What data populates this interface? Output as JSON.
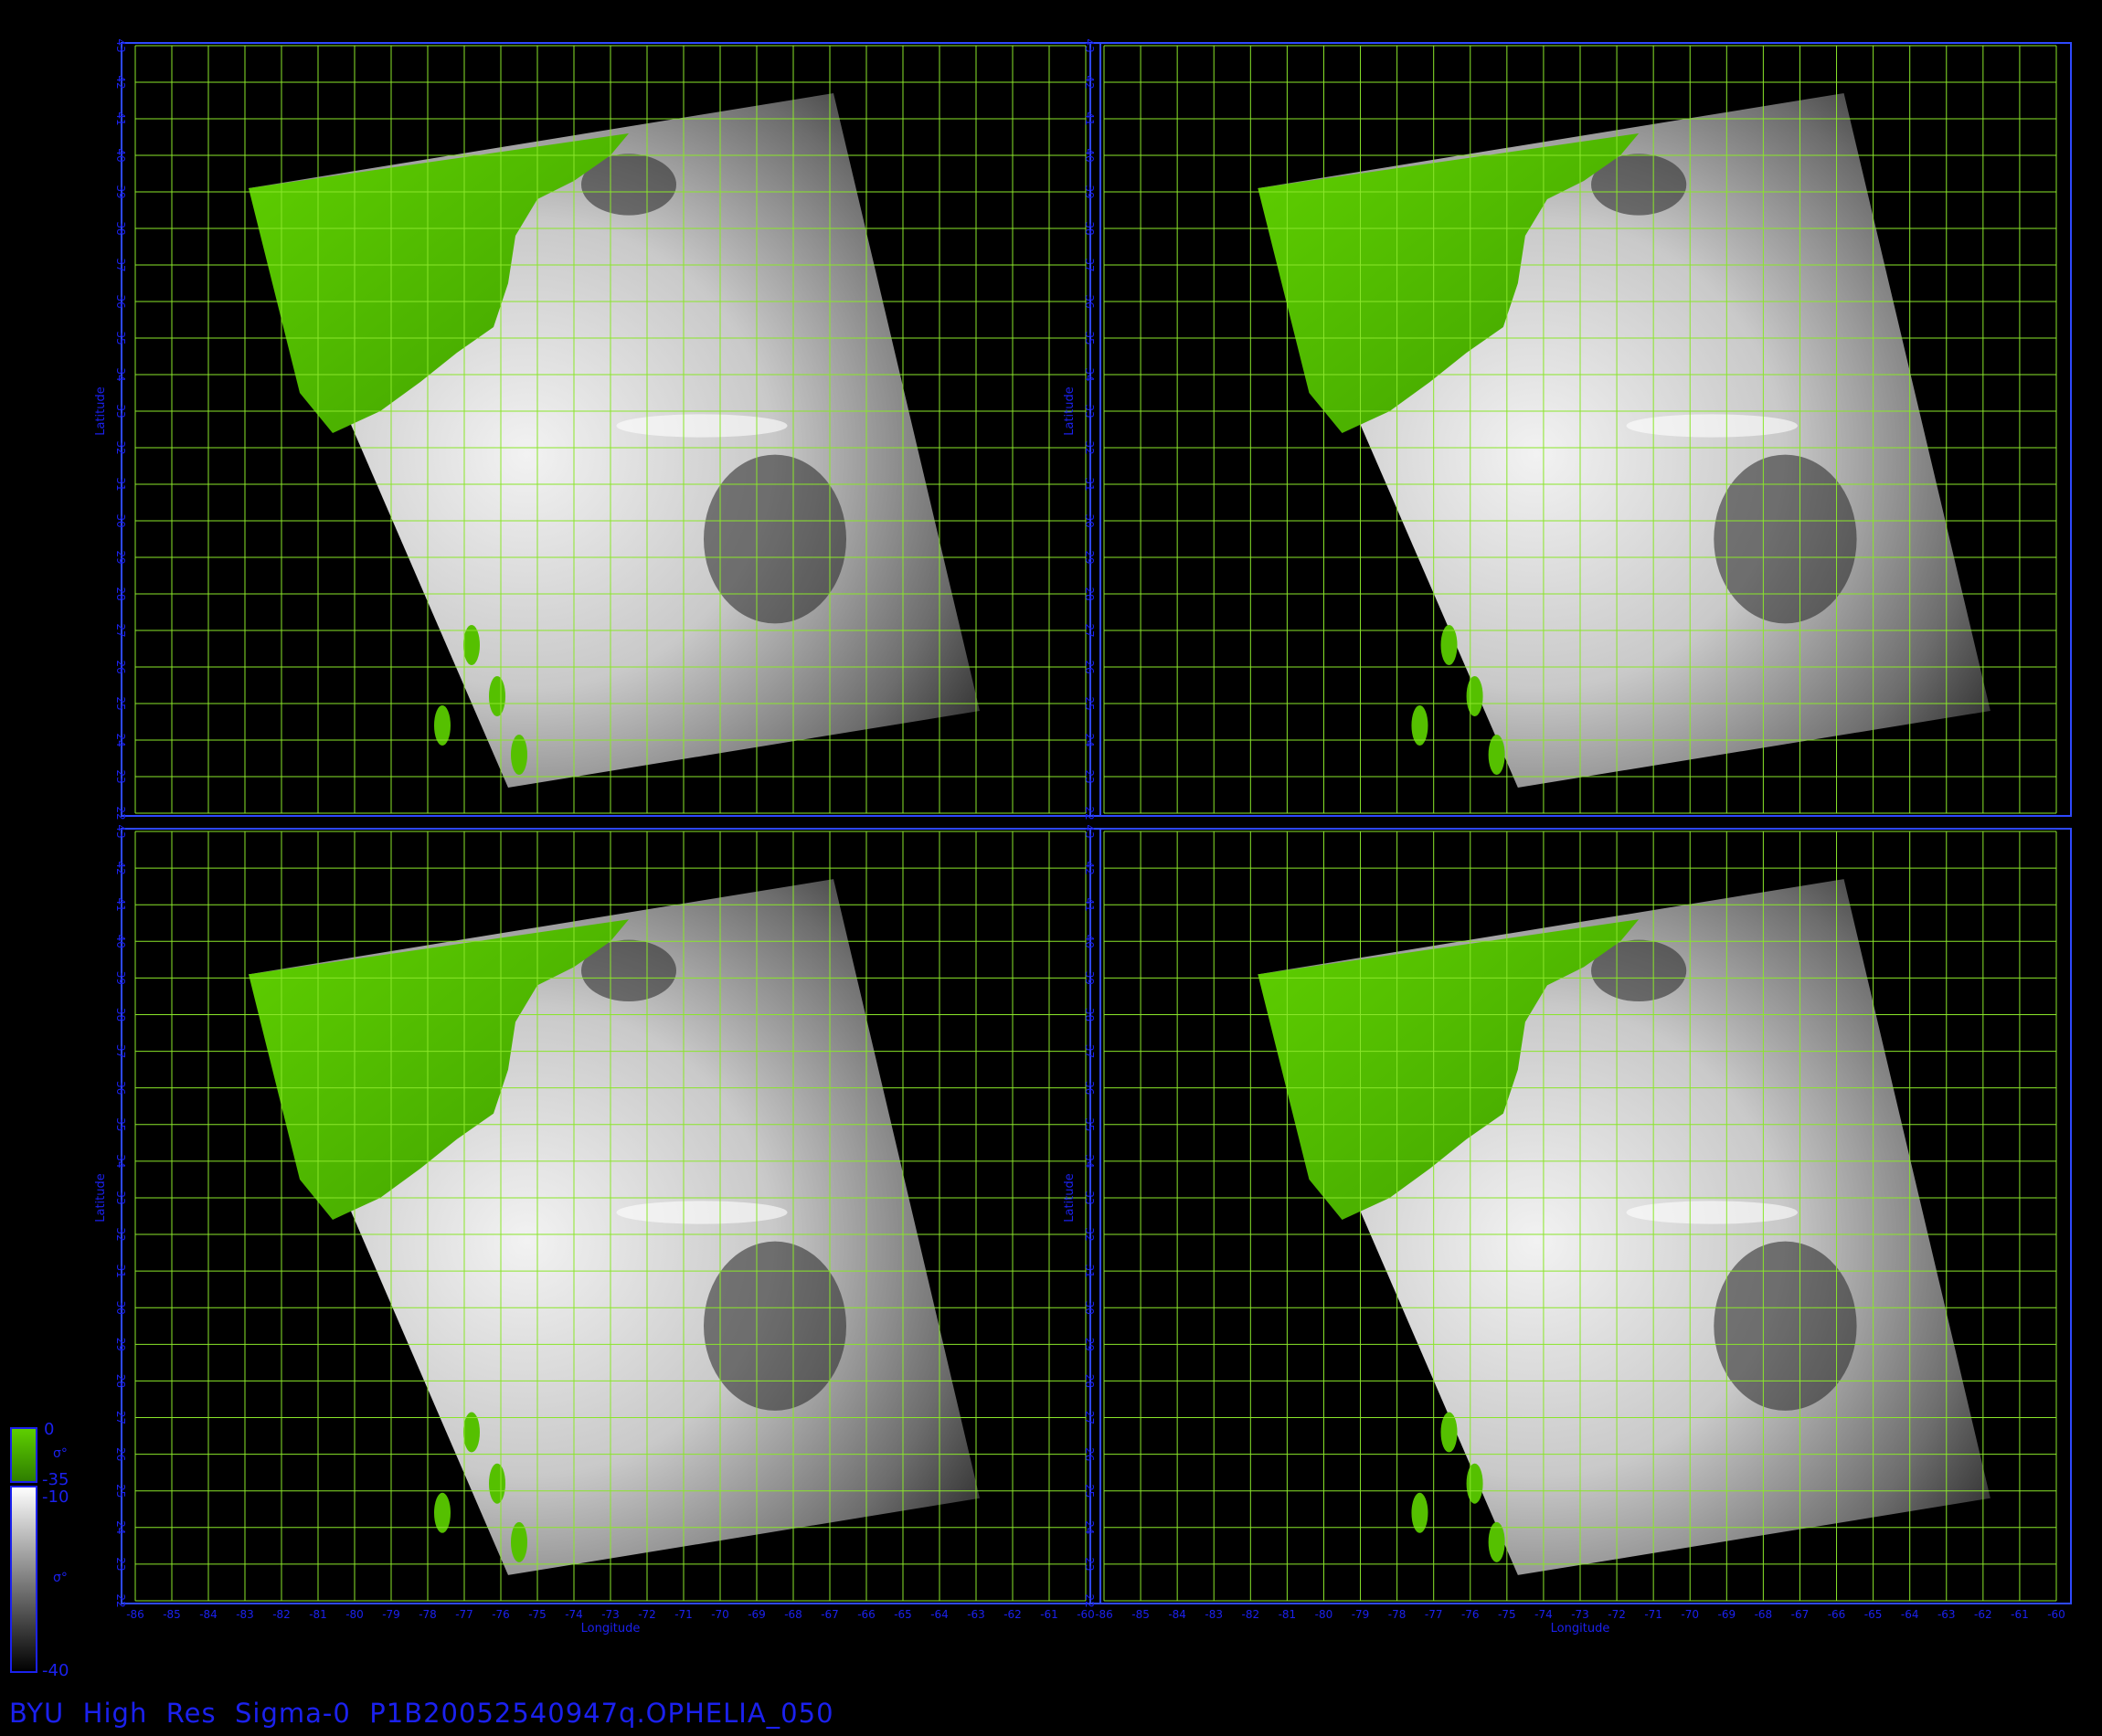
{
  "title": "BYU  High  Res  Sigma-0  P1B20052540947q.OPHELIA_050",
  "axes": {
    "x_label": "Longitude",
    "y_label": "Latitude",
    "lon_range": [
      -86,
      -60
    ],
    "lat_range": [
      22,
      43
    ],
    "lon_ticks": [
      "-86",
      "-85",
      "-84",
      "-83",
      "-82",
      "-81",
      "-80",
      "-79",
      "-78",
      "-77",
      "-76",
      "-75",
      "-74",
      "-73",
      "-72",
      "-71",
      "-70",
      "-69",
      "-68",
      "-67",
      "-66",
      "-65",
      "-64",
      "-63",
      "-62",
      "-61",
      "-60"
    ],
    "lat_ticks": [
      "22",
      "23",
      "24",
      "25",
      "26",
      "27",
      "28",
      "29",
      "30",
      "31",
      "32",
      "33",
      "34",
      "35",
      "36",
      "37",
      "38",
      "39",
      "40",
      "41",
      "42",
      "43"
    ]
  },
  "colorbar": {
    "land_top": "0",
    "land_bottom": "-35",
    "ocean_top": "-10",
    "ocean_bottom": "-40",
    "symbol": "σ°",
    "land_color": "#4bbf00",
    "ocean_high_color": "#ffffff",
    "ocean_low_color": "#000000"
  },
  "colors": {
    "frame": "#2e49ff",
    "label": "#1b21ee",
    "grid": "#8ae62a",
    "land": "#55c000"
  },
  "panels": [
    {
      "id": "top-left"
    },
    {
      "id": "top-right"
    },
    {
      "id": "bottom-left"
    },
    {
      "id": "bottom-right"
    }
  ]
}
